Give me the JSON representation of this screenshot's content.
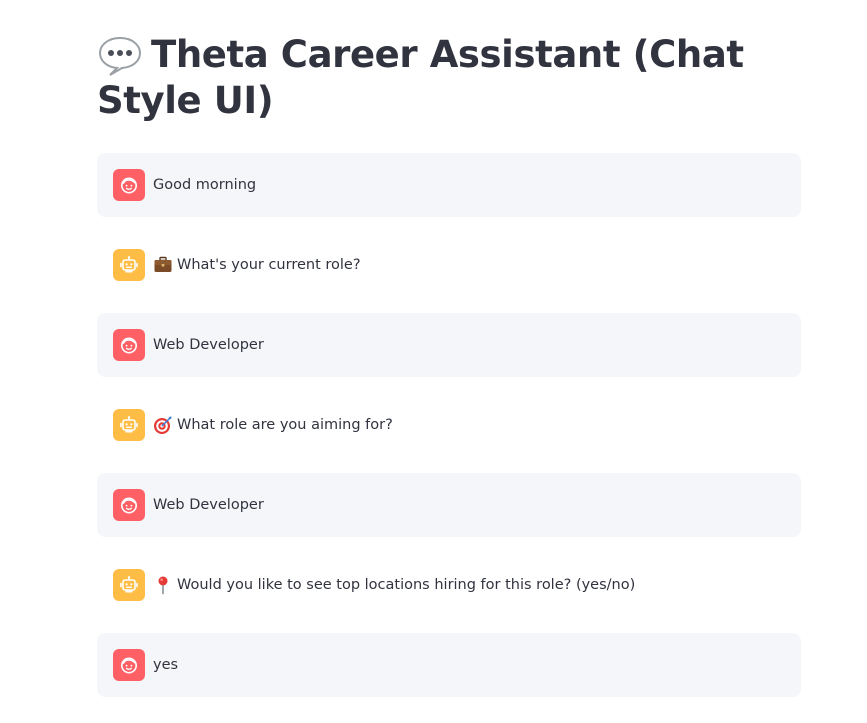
{
  "page": {
    "title_icon": "speech-balloon-icon",
    "title": "Theta Career Assistant (Chat Style UI)"
  },
  "colors": {
    "user_avatar_bg": "#ff6066",
    "assistant_avatar_bg": "#ffbd45",
    "user_message_bg": "#f5f6f9",
    "text": "#31333f"
  },
  "messages": [
    {
      "role": "user",
      "avatar_icon": "user-face-icon",
      "emoji_icon": "",
      "text": "Good morning"
    },
    {
      "role": "assistant",
      "avatar_icon": "robot-icon",
      "emoji_icon": "briefcase-icon",
      "text": "What's your current role?"
    },
    {
      "role": "user",
      "avatar_icon": "user-face-icon",
      "emoji_icon": "",
      "text": "Web Developer"
    },
    {
      "role": "assistant",
      "avatar_icon": "robot-icon",
      "emoji_icon": "target-icon",
      "text": "What role are you aiming for?"
    },
    {
      "role": "user",
      "avatar_icon": "user-face-icon",
      "emoji_icon": "",
      "text": "Web Developer"
    },
    {
      "role": "assistant",
      "avatar_icon": "robot-icon",
      "emoji_icon": "pin-icon",
      "text": "Would you like to see top locations hiring for this role? (yes/no)"
    },
    {
      "role": "user",
      "avatar_icon": "user-face-icon",
      "emoji_icon": "",
      "text": "yes"
    }
  ]
}
